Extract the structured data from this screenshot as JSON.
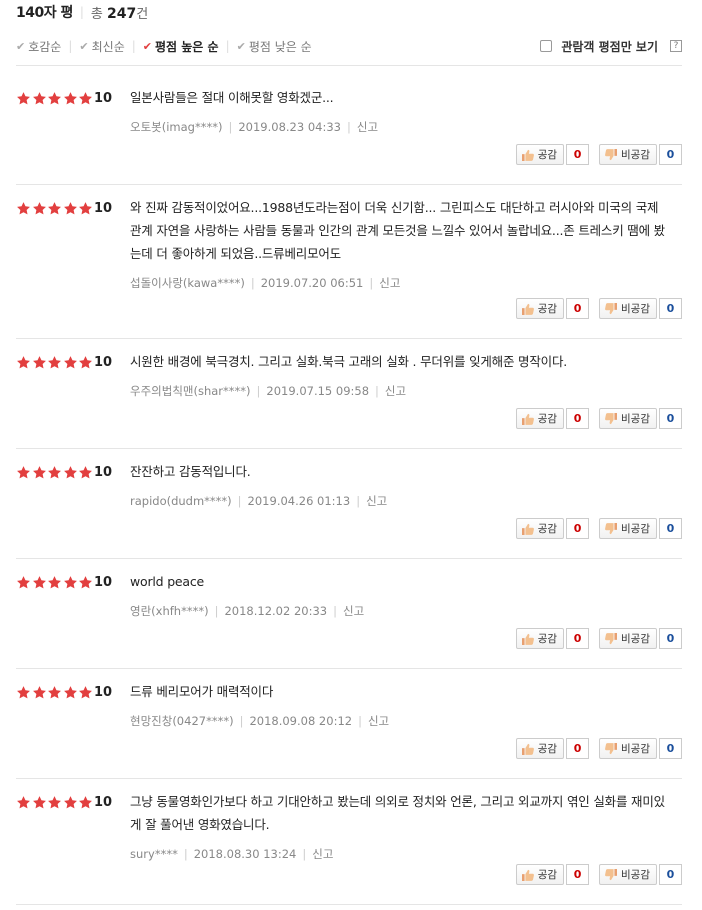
{
  "header": {
    "title": "140자 평",
    "total_prefix": "총",
    "total_count": "247",
    "total_suffix": "건"
  },
  "sort": {
    "items": [
      {
        "label": "호감순",
        "active": false
      },
      {
        "label": "최신순",
        "active": false
      },
      {
        "label": "평점 높은 순",
        "active": true
      },
      {
        "label": "평점 낮은 순",
        "active": false
      }
    ],
    "viewer_only_label": "관람객 평점만 보기",
    "help_label": "?"
  },
  "colors": {
    "star": "#e23f3f",
    "accent_check": "#e23f3f",
    "like_count": "#cc0000",
    "dislike_count": "#1b4f9c"
  },
  "vote_labels": {
    "like": "공감",
    "dislike": "비공감"
  },
  "reviews": [
    {
      "rating": 5,
      "score": "10",
      "text": "일본사람들은 절대 이해못할 영화겠군...",
      "user": "오토봇(imag****)",
      "date": "2019.08.23 04:33",
      "report": "신고",
      "likes": "0",
      "dislikes": "0"
    },
    {
      "rating": 5,
      "score": "10",
      "text": "와 진짜 감동적이었어요...1988년도라는점이 더욱 신기함... 그린피스도 대단하고 러시아와 미국의 국제관계 자연을 사랑하는 사람들 동물과 인간의 관계 모든것을 느낄수 있어서 놀랍네요...존 트레스키 땜에 봤는데 더 좋아하게 되었음..드류베리모어도",
      "user": "섭돌이사랑(kawa****)",
      "date": "2019.07.20 06:51",
      "report": "신고",
      "likes": "0",
      "dislikes": "0"
    },
    {
      "rating": 5,
      "score": "10",
      "text": "시원한 배경에 북극경치. 그리고 실화.북극 고래의 실화 . 무더위를 잊게해준 명작이다.",
      "user": "우주의법칙맨(shar****)",
      "date": "2019.07.15 09:58",
      "report": "신고",
      "likes": "0",
      "dislikes": "0"
    },
    {
      "rating": 5,
      "score": "10",
      "text": "잔잔하고 감동적입니다.",
      "user": "rapido(dudm****)",
      "date": "2019.04.26 01:13",
      "report": "신고",
      "likes": "0",
      "dislikes": "0"
    },
    {
      "rating": 5,
      "score": "10",
      "text": "world peace",
      "user": "영란(xhfh****)",
      "date": "2018.12.02 20:33",
      "report": "신고",
      "likes": "0",
      "dislikes": "0"
    },
    {
      "rating": 5,
      "score": "10",
      "text": "드류 베리모어가 매력적이다",
      "user": "현망진창(0427****)",
      "date": "2018.09.08 20:12",
      "report": "신고",
      "likes": "0",
      "dislikes": "0"
    },
    {
      "rating": 5,
      "score": "10",
      "text": "그냥 동물영화인가보다 하고 기대안하고 봤는데 의외로 정치와 언론, 그리고 외교까지 엮인 실화를 재미있게 잘 풀어낸 영화였습니다.",
      "user": "sury****",
      "date": "2018.08.30 13:24",
      "report": "신고",
      "likes": "0",
      "dislikes": "0"
    }
  ]
}
